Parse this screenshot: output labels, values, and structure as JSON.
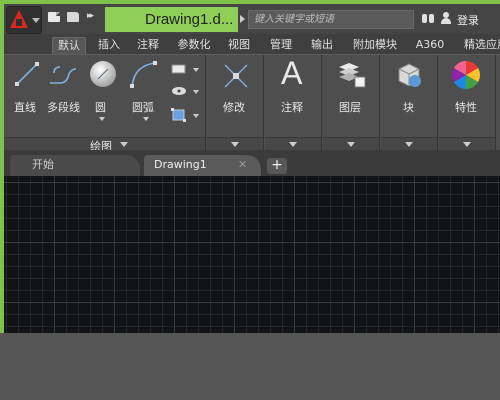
{
  "window": {
    "title": "Drawing1.d...",
    "frame_color": "#7ec24a"
  },
  "titlebar": {
    "app_menu_icon": "autocad-a-icon",
    "quick_access": [
      "new-file-icon",
      "open-folder-icon",
      "more-icon"
    ],
    "more_glyph": "▸▸",
    "search_placeholder": "键入关键字或短语",
    "login_label": "登录"
  },
  "ribbon_tabs": [
    {
      "label": "默认",
      "active": true
    },
    {
      "label": "插入"
    },
    {
      "label": "注释"
    },
    {
      "label": "参数化"
    },
    {
      "label": "视图"
    },
    {
      "label": "管理"
    },
    {
      "label": "输出"
    },
    {
      "label": "附加模块"
    },
    {
      "label": "A360"
    },
    {
      "label": "精选应用"
    }
  ],
  "ribbon": {
    "draw_panel": {
      "tools": [
        {
          "label": "直线",
          "icon": "line-icon"
        },
        {
          "label": "多段线",
          "icon": "polyline-icon"
        },
        {
          "label": "圆",
          "icon": "circle-icon"
        },
        {
          "label": "圆弧",
          "icon": "arc-icon"
        }
      ],
      "small_tools": [
        "rectangle-icon",
        "ellipse-icon",
        "hatch-icon"
      ],
      "footer_label": "绘图"
    },
    "modify_label": "修改",
    "annotate_label": "注释",
    "annotate_glyph": "A",
    "layers_label": "图层",
    "block_label": "块",
    "properties_label": "特性"
  },
  "file_tabs": [
    {
      "label": "开始"
    },
    {
      "label": "Drawing1",
      "active": true
    }
  ],
  "new_tab_label": "+",
  "close_glyph": "✕"
}
